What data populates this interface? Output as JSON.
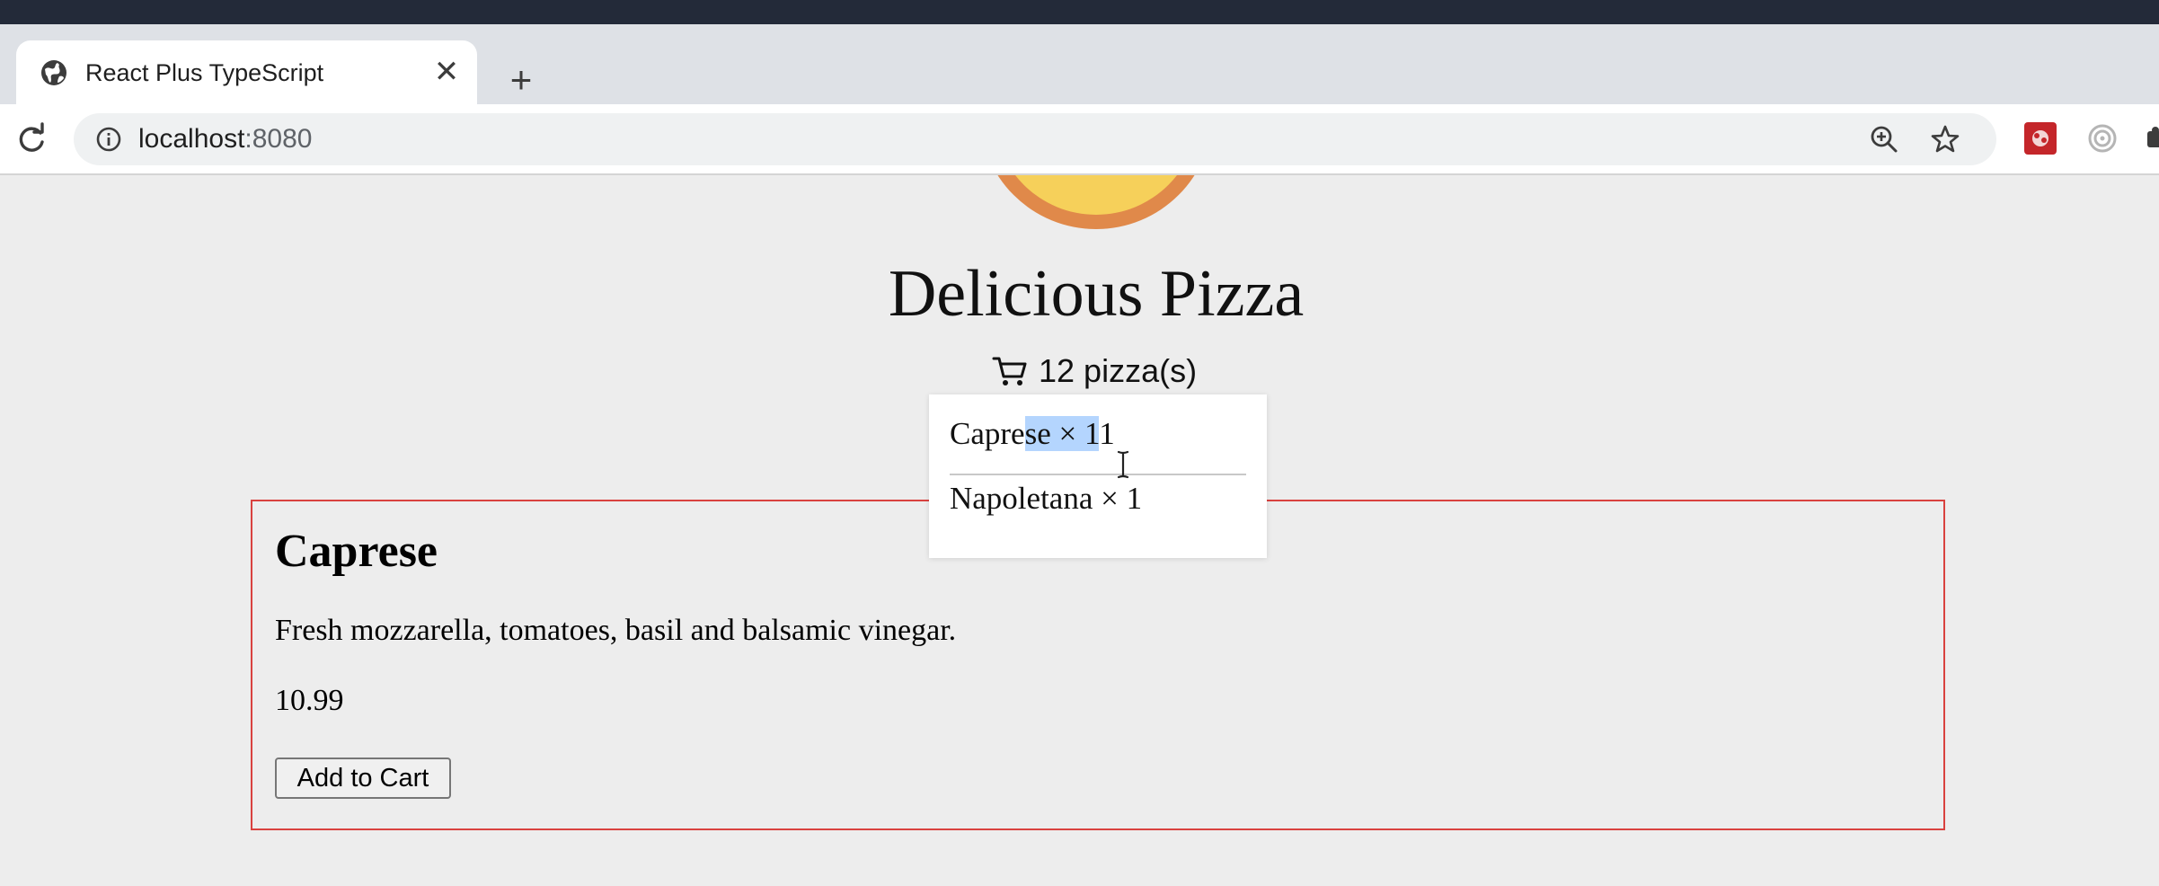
{
  "browser": {
    "tab_title": "React Plus TypeScript",
    "tab_close": "✕",
    "new_tab": "+",
    "url_host": "localhost",
    "url_port": ":8080"
  },
  "page": {
    "title": "Delicious Pizza",
    "cart": {
      "summary": "12 pizza(s)",
      "items": [
        {
          "name_before_selection": "Capre",
          "name_selected": "se × 1",
          "name_after_selection": "1"
        },
        {
          "label": "Napoletana × 1"
        }
      ]
    },
    "pizza": {
      "name": "Caprese",
      "description": "Fresh mozzarella, tomatoes, basil and balsamic vinegar.",
      "price": "10.99",
      "add_button": "Add to Cart"
    }
  },
  "colors": {
    "card_border": "#d9423f",
    "selection": "#b4d5fe",
    "tabstrip": "#dee1e6",
    "top_strip": "#232a39"
  }
}
